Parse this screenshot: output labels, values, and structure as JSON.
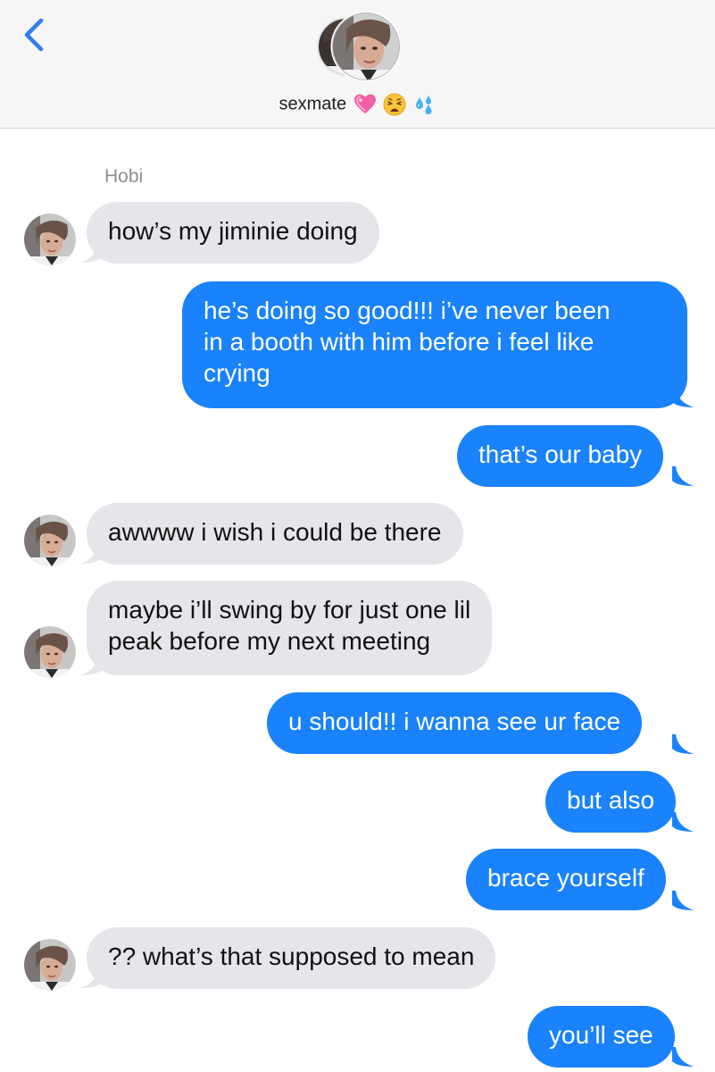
{
  "header": {
    "contact_name": "sexmate",
    "name_emojis": [
      "pink-heart-icon",
      "weary-face-icon",
      "sweat-droplets-icon"
    ]
  },
  "thread": {
    "sender_name": "Hobi",
    "messages": [
      {
        "from": "them",
        "lines": [
          "how’s my jiminie doing"
        ]
      },
      {
        "from": "me",
        "lines": [
          "he’s doing so good!!! i’ve never been",
          "in a booth with him before i feel like",
          "crying"
        ]
      },
      {
        "from": "me",
        "lines": [
          "that’s our baby"
        ]
      },
      {
        "from": "them",
        "lines": [
          "awwww i wish i could be there"
        ]
      },
      {
        "from": "them",
        "lines": [
          "maybe i’ll swing by for just one lil",
          "peak before my next meeting"
        ]
      },
      {
        "from": "me",
        "lines": [
          "u should!! i wanna see ur face"
        ]
      },
      {
        "from": "me",
        "lines": [
          "but also"
        ]
      },
      {
        "from": "me",
        "lines": [
          "brace yourself"
        ]
      },
      {
        "from": "them",
        "lines": [
          "?? what’s that supposed to mean"
        ]
      },
      {
        "from": "me",
        "lines": [
          "you’ll see"
        ]
      }
    ]
  },
  "colors": {
    "outgoing_bubble": "#1a82fb",
    "incoming_bubble": "#e5e5ea",
    "accent": "#2f7cf6",
    "header_background": "#f6f6f6"
  }
}
